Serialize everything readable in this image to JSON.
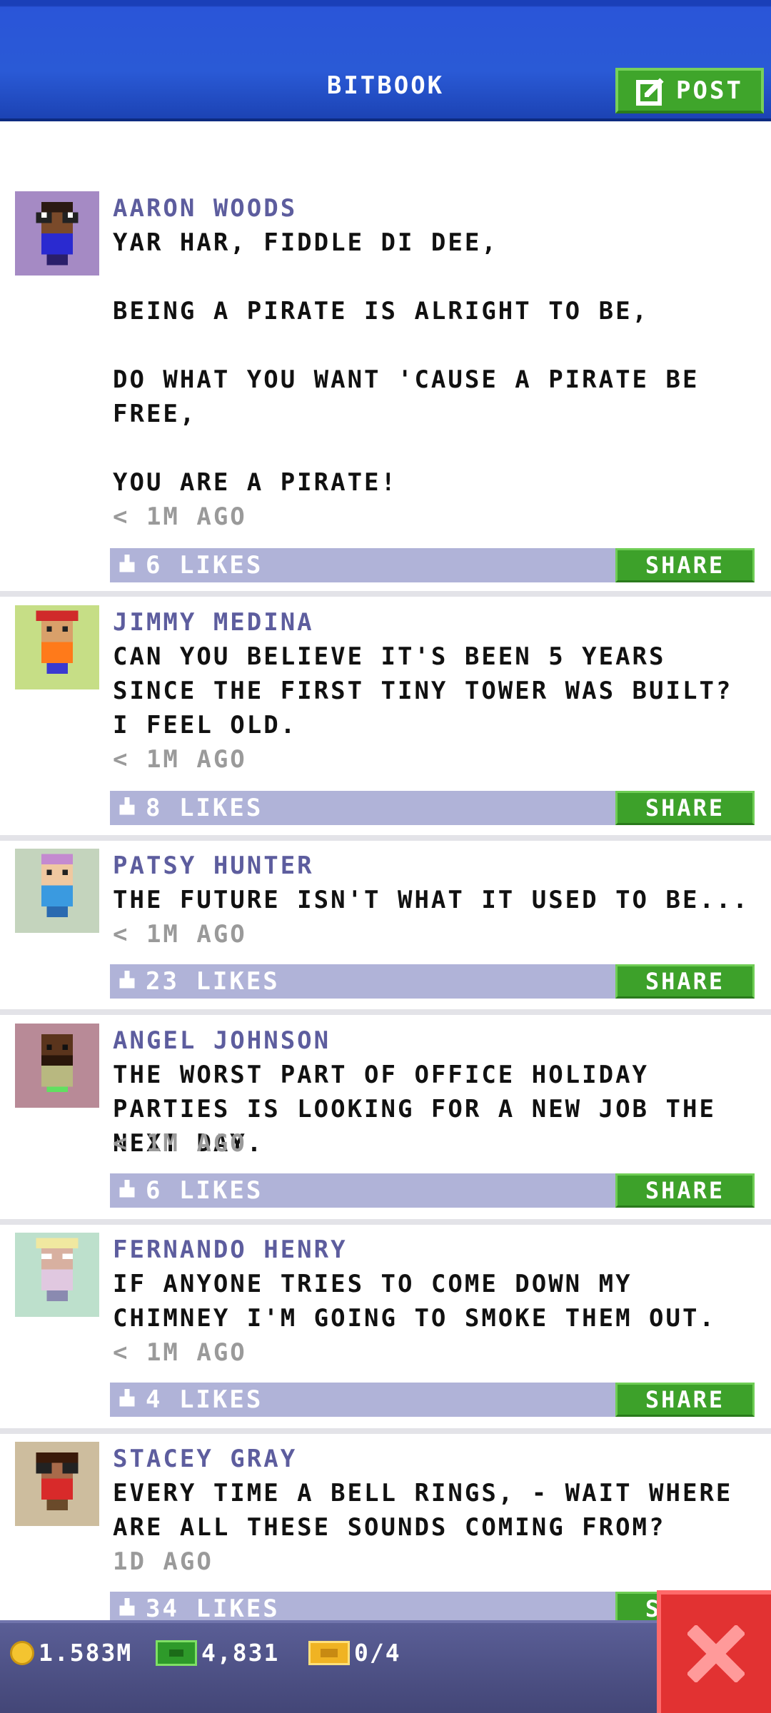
{
  "header": {
    "title": "BITBOOK",
    "post_label": "POST"
  },
  "posts": [
    {
      "name": "AARON WOODS",
      "text": "YAR HAR, FIDDLE DI DEE,\n\nBEING A PIRATE IS ALRIGHT TO BE,\n\nDO WHAT YOU WANT 'CAUSE A PIRATE BE FREE,\n\nYOU ARE A PIRATE!",
      "time": "< 1M AGO",
      "likes": "6 LIKES",
      "share": "SHARE",
      "avatar_bg": "#a58ac4"
    },
    {
      "name": "JIMMY MEDINA",
      "text": "CAN YOU BELIEVE IT'S BEEN 5 YEARS SINCE THE FIRST TINY TOWER WAS BUILT? I FEEL OLD.",
      "time": "< 1M AGO",
      "likes": "8 LIKES",
      "share": "SHARE",
      "avatar_bg": "#c6de86"
    },
    {
      "name": "PATSY HUNTER",
      "text": "THE FUTURE ISN'T WHAT IT USED TO BE...",
      "time": "< 1M AGO",
      "likes": "23 LIKES",
      "share": "SHARE",
      "avatar_bg": "#c4d4bd"
    },
    {
      "name": "ANGEL JOHNSON",
      "text": "THE WORST PART OF OFFICE HOLIDAY PARTIES IS LOOKING FOR A NEW JOB THE NEXT DAY.",
      "time": "< 1M AGO",
      "likes": "6 LIKES",
      "share": "SHARE",
      "avatar_bg": "#b88a97"
    },
    {
      "name": "FERNANDO HENRY",
      "text": "IF ANYONE TRIES TO COME DOWN MY CHIMNEY I'M GOING TO SMOKE THEM OUT.",
      "time": "< 1M AGO",
      "likes": "4 LIKES",
      "share": "SHARE",
      "avatar_bg": "#bde0cc"
    },
    {
      "name": "STACEY GRAY",
      "text": "EVERY TIME A BELL RINGS, - WAIT WHERE ARE ALL THESE SOUNDS COMING FROM?",
      "time": "1D AGO",
      "likes": "34 LIKES",
      "share": "SHARE",
      "avatar_bg": "#cdbd9e"
    }
  ],
  "footer": {
    "coins": "1.583M",
    "bux": "4,831",
    "tickets": "0/4"
  },
  "colors": {
    "header_blue": "#2a55d8",
    "share_green": "#3da12a",
    "likes_bar": "#b0b3d8",
    "close_red": "#e23232"
  }
}
